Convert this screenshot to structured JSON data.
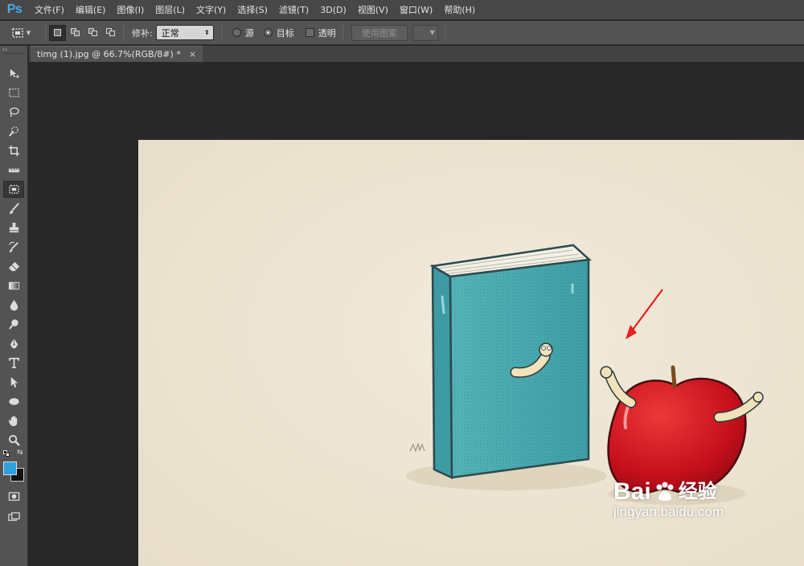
{
  "app": {
    "logo": "Ps"
  },
  "menu": [
    {
      "label": "文件(F)"
    },
    {
      "label": "编辑(E)"
    },
    {
      "label": "图像(I)"
    },
    {
      "label": "图层(L)"
    },
    {
      "label": "文字(Y)"
    },
    {
      "label": "选择(S)"
    },
    {
      "label": "滤镜(T)"
    },
    {
      "label": "3D(D)"
    },
    {
      "label": "视图(V)"
    },
    {
      "label": "窗口(W)"
    },
    {
      "label": "帮助(H)"
    }
  ],
  "options": {
    "patch_label": "修补:",
    "patch_mode": "正常",
    "source_label": "源",
    "destination_label": "目标",
    "transparent_label": "透明",
    "use_pattern_label": "使用图案"
  },
  "document": {
    "tab_title": "timg (1).jpg @ 66.7%(RGB/8#) *",
    "close_glyph": "×"
  },
  "watermark": {
    "brand": "Bai",
    "brand_suffix": "经验",
    "url": "jingyan.baidu.com"
  },
  "colors": {
    "foreground": "#2f9fde",
    "background": "#111111",
    "annotation_arrow": "#e8201f"
  },
  "icons": [
    "selection-brush-icon",
    "move-icon",
    "marquee-icon",
    "lasso-icon",
    "quick-select-icon",
    "crop-icon",
    "ruler-icon",
    "patch-icon",
    "brush-icon",
    "stamp-icon",
    "history-brush-icon",
    "eraser-icon",
    "gradient-icon",
    "blur-icon",
    "dodge-icon",
    "pen-icon",
    "type-icon",
    "path-select-icon",
    "ellipse-icon",
    "hand-icon",
    "zoom-icon",
    "quick-mask-icon",
    "screen-mode-icon"
  ]
}
